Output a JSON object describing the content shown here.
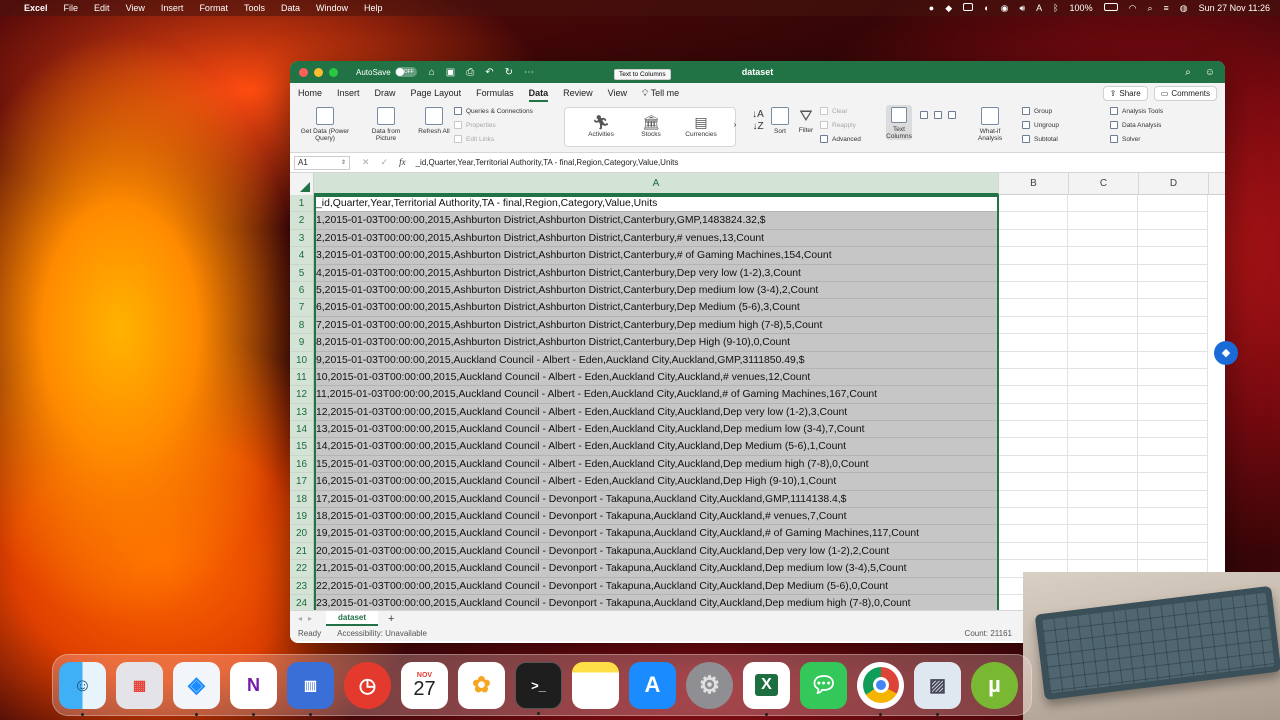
{
  "menubar": {
    "app_name": "Excel",
    "items": [
      "File",
      "Edit",
      "View",
      "Insert",
      "Format",
      "Tools",
      "Data",
      "Window",
      "Help"
    ],
    "battery": "100%",
    "datetime": "Sun 27 Nov  11:26"
  },
  "window": {
    "title": "dataset",
    "autosave_label": "AutoSave",
    "autosave_state": "OFF"
  },
  "tabs": [
    "Home",
    "Insert",
    "Draw",
    "Page Layout",
    "Formulas",
    "Data",
    "Review",
    "View"
  ],
  "active_tab": "Data",
  "tell_me": "Tell me",
  "share_label": "Share",
  "comments_label": "Comments",
  "ribbon": {
    "get_data": "Get Data (Power Query)",
    "data_from_picture": "Data from Picture",
    "refresh_all": "Refresh All",
    "queries_connections": "Queries & Connections",
    "properties": "Properties",
    "edit_links": "Edit Links",
    "activities": "Activities",
    "stocks": "Stocks",
    "currencies": "Currencies",
    "sort": "Sort",
    "filter": "Filter",
    "clear": "Clear",
    "reapply": "Reapply",
    "advanced": "Advanced",
    "text_to_columns_a": "Text",
    "text_to_columns_b": "Columns",
    "what_if": "What-if Analysis",
    "group": "Group",
    "ungroup": "Ungroup",
    "subtotal": "Subtotal",
    "analysis_tools": "Analysis Tools",
    "data_analysis": "Data Analysis",
    "solver": "Solver"
  },
  "tooltip": "Text to Columns",
  "formula_bar": {
    "cell_ref": "A1",
    "fx": "fx",
    "content": "_id,Quarter,Year,Territorial Authority,TA - final,Region,Category,Value,Units"
  },
  "columns": [
    "A",
    "B",
    "C",
    "D"
  ],
  "rows": [
    {
      "n": "1",
      "a": "_id,Quarter,Year,Territorial Authority,TA - final,Region,Category,Value,Units"
    },
    {
      "n": "2",
      "a": "1,2015-01-03T00:00:00,2015,Ashburton District,Ashburton District,Canterbury,GMP,1483824.32,$"
    },
    {
      "n": "3",
      "a": "2,2015-01-03T00:00:00,2015,Ashburton District,Ashburton District,Canterbury,# venues,13,Count"
    },
    {
      "n": "4",
      "a": "3,2015-01-03T00:00:00,2015,Ashburton District,Ashburton District,Canterbury,# of Gaming Machines,154,Count"
    },
    {
      "n": "5",
      "a": "4,2015-01-03T00:00:00,2015,Ashburton District,Ashburton District,Canterbury,Dep very low (1-2),3,Count"
    },
    {
      "n": "6",
      "a": "5,2015-01-03T00:00:00,2015,Ashburton District,Ashburton District,Canterbury,Dep medium low (3-4),2,Count"
    },
    {
      "n": "7",
      "a": "6,2015-01-03T00:00:00,2015,Ashburton District,Ashburton District,Canterbury,Dep Medium (5-6),3,Count"
    },
    {
      "n": "8",
      "a": "7,2015-01-03T00:00:00,2015,Ashburton District,Ashburton District,Canterbury,Dep medium high (7-8),5,Count"
    },
    {
      "n": "9",
      "a": "8,2015-01-03T00:00:00,2015,Ashburton District,Ashburton District,Canterbury,Dep High (9-10),0,Count"
    },
    {
      "n": "10",
      "a": "9,2015-01-03T00:00:00,2015,Auckland Council - Albert - Eden,Auckland City,Auckland,GMP,3111850.49,$"
    },
    {
      "n": "11",
      "a": "10,2015-01-03T00:00:00,2015,Auckland Council - Albert - Eden,Auckland City,Auckland,# venues,12,Count"
    },
    {
      "n": "12",
      "a": "11,2015-01-03T00:00:00,2015,Auckland Council - Albert - Eden,Auckland City,Auckland,# of Gaming Machines,167,Count"
    },
    {
      "n": "13",
      "a": "12,2015-01-03T00:00:00,2015,Auckland Council - Albert - Eden,Auckland City,Auckland,Dep very low (1-2),3,Count"
    },
    {
      "n": "14",
      "a": "13,2015-01-03T00:00:00,2015,Auckland Council - Albert - Eden,Auckland City,Auckland,Dep medium low (3-4),7,Count"
    },
    {
      "n": "15",
      "a": "14,2015-01-03T00:00:00,2015,Auckland Council - Albert - Eden,Auckland City,Auckland,Dep Medium (5-6),1,Count"
    },
    {
      "n": "16",
      "a": "15,2015-01-03T00:00:00,2015,Auckland Council - Albert - Eden,Auckland City,Auckland,Dep medium high (7-8),0,Count"
    },
    {
      "n": "17",
      "a": "16,2015-01-03T00:00:00,2015,Auckland Council - Albert - Eden,Auckland City,Auckland,Dep High (9-10),1,Count"
    },
    {
      "n": "18",
      "a": "17,2015-01-03T00:00:00,2015,Auckland Council - Devonport - Takapuna,Auckland City,Auckland,GMP,1114138.4,$"
    },
    {
      "n": "19",
      "a": "18,2015-01-03T00:00:00,2015,Auckland Council - Devonport - Takapuna,Auckland City,Auckland,# venues,7,Count"
    },
    {
      "n": "20",
      "a": "19,2015-01-03T00:00:00,2015,Auckland Council - Devonport - Takapuna,Auckland City,Auckland,# of Gaming Machines,117,Count"
    },
    {
      "n": "21",
      "a": "20,2015-01-03T00:00:00,2015,Auckland Council - Devonport - Takapuna,Auckland City,Auckland,Dep very low (1-2),2,Count"
    },
    {
      "n": "22",
      "a": "21,2015-01-03T00:00:00,2015,Auckland Council - Devonport - Takapuna,Auckland City,Auckland,Dep medium low (3-4),5,Count"
    },
    {
      "n": "23",
      "a": "22,2015-01-03T00:00:00,2015,Auckland Council - Devonport - Takapuna,Auckland City,Auckland,Dep Medium (5-6),0,Count"
    },
    {
      "n": "24",
      "a": "23,2015-01-03T00:00:00,2015,Auckland Council - Devonport - Takapuna,Auckland City,Auckland,Dep medium high (7-8),0,Count"
    }
  ],
  "sheet_tab": "dataset",
  "status": {
    "ready": "Ready",
    "accessibility": "Accessibility: Unavailable",
    "count": "Count: 21161"
  },
  "dock": {
    "calendar_month": "NOV",
    "calendar_day": "27",
    "apps": [
      "finder",
      "launchpad",
      "safari",
      "onenote",
      "parallels",
      "timing",
      "calendar",
      "photos",
      "terminal",
      "notes",
      "app-store",
      "system-preferences",
      "excel",
      "messages",
      "chrome",
      "preview",
      "utorrent"
    ]
  },
  "colors": {
    "excel_green": "#217346",
    "selection_fill": "#c6c6c6",
    "header_selected": "#d3e3d6"
  }
}
